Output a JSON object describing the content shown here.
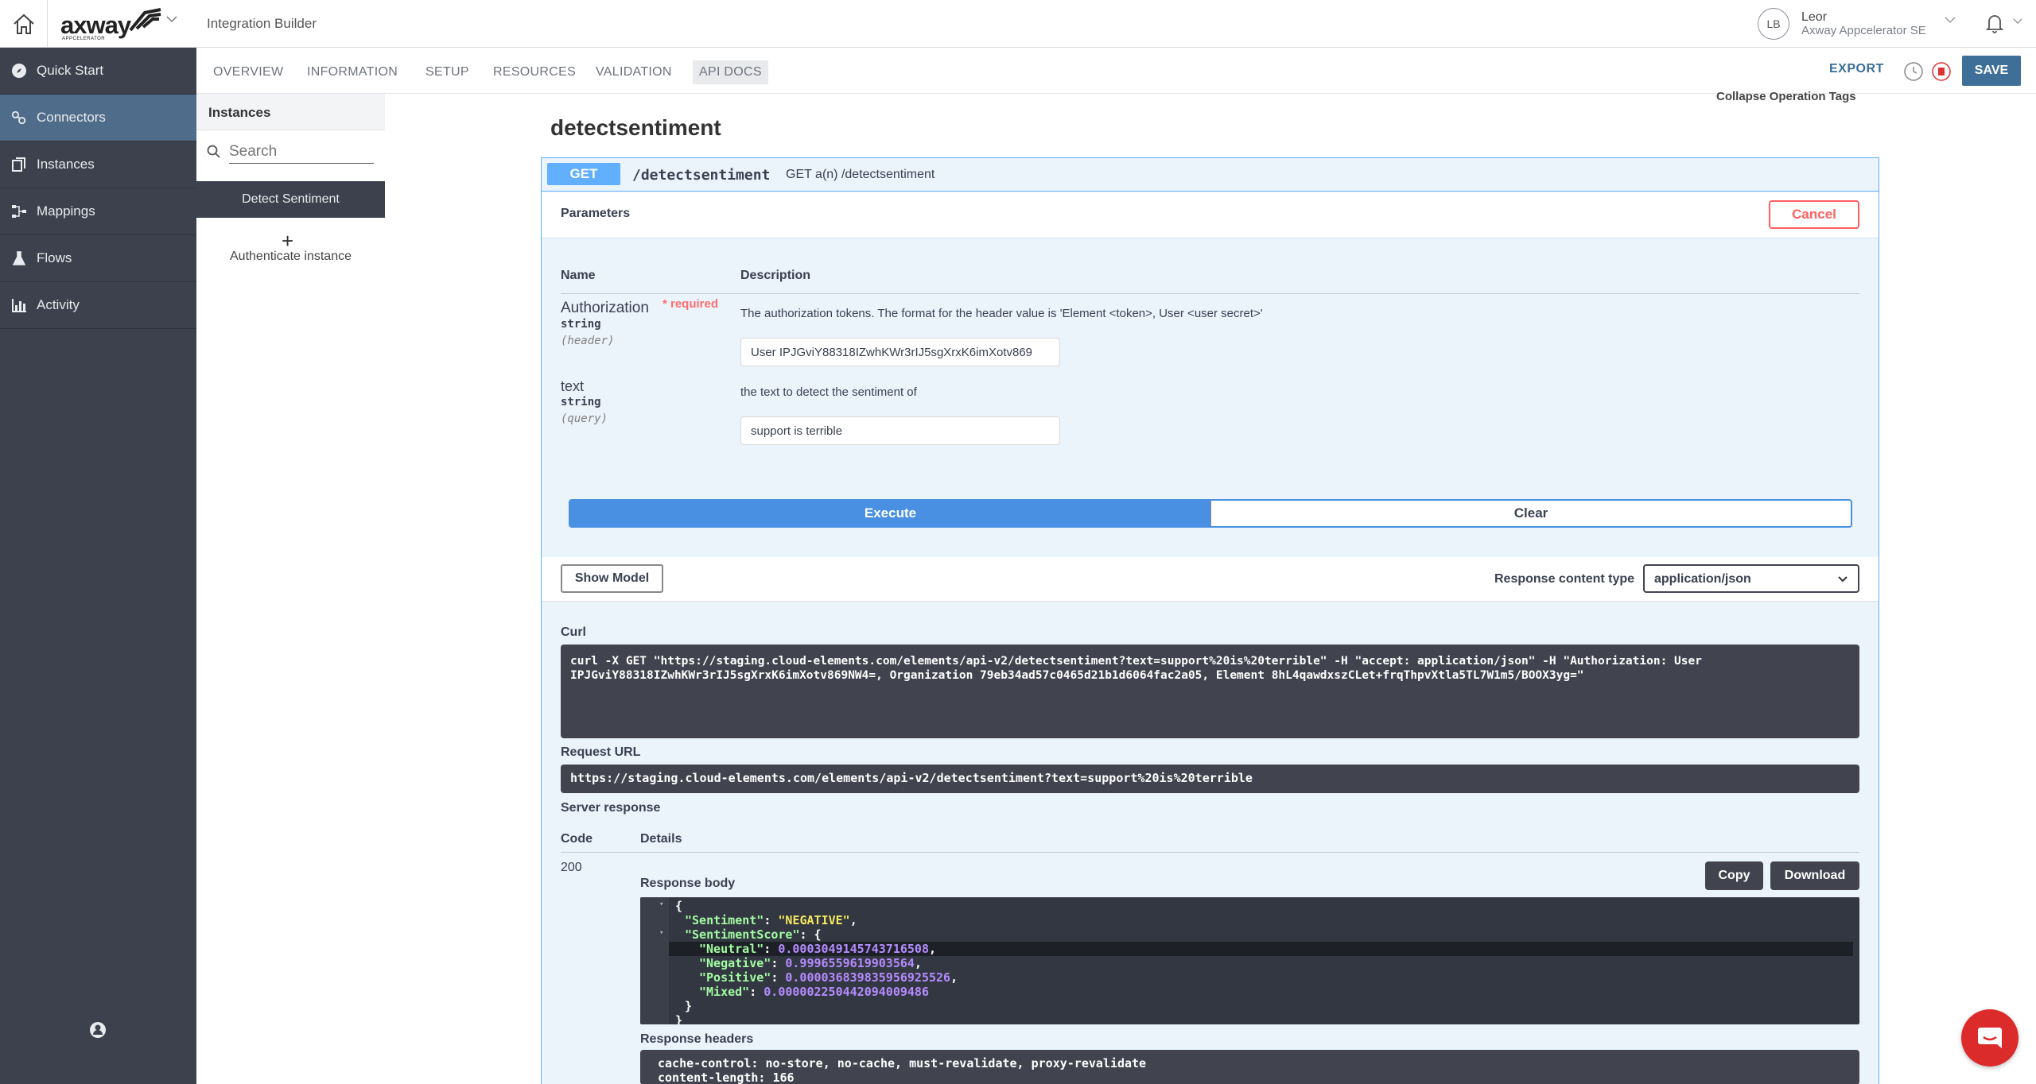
{
  "topbar": {
    "logo_text": "axway",
    "logo_sub": "APPCELERATOR",
    "app_title": "Integration Builder",
    "user_initials": "LB",
    "user_name": "Leor",
    "user_org": "Axway Appcelerator SE"
  },
  "sidebar": {
    "items": [
      {
        "label": "Quick Start",
        "icon": "compass-icon"
      },
      {
        "label": "Connectors",
        "icon": "connectors-icon",
        "active": true
      },
      {
        "label": "Instances",
        "icon": "instances-icon"
      },
      {
        "label": "Mappings",
        "icon": "mappings-icon"
      },
      {
        "label": "Flows",
        "icon": "flask-icon"
      },
      {
        "label": "Activity",
        "icon": "bar-chart-icon"
      }
    ],
    "active_color": "#4f6d8a",
    "bg_color": "#3c414d"
  },
  "tabs": [
    "OVERVIEW",
    "INFORMATION",
    "SETUP",
    "RESOURCES",
    "VALIDATION",
    "API DOCS"
  ],
  "active_tab": "API DOCS",
  "actions": {
    "export": "EXPORT",
    "save": "SAVE"
  },
  "instances": {
    "header": "Instances",
    "search_placeholder": "Search",
    "selected": "Detect Sentiment",
    "add_label": "+",
    "authenticate": "Authenticate instance"
  },
  "api": {
    "collapse_tags": "Collapse Operation Tags",
    "title": "detectsentiment",
    "method": "GET",
    "path": "/detectsentiment",
    "summary": "GET a(n) /detectsentiment",
    "parameters_title": "Parameters",
    "cancel": "Cancel",
    "col_name": "Name",
    "col_description": "Description",
    "params": [
      {
        "name": "Authorization",
        "required": "* required",
        "type": "string",
        "in": "(header)",
        "description": "The authorization tokens. The format for the header value is 'Element <token>, User <user secret>'",
        "value": "User IPJGviY88318IZwhKWr3rIJ5sgXrxK6imXotv869"
      },
      {
        "name": "text",
        "type": "string",
        "in": "(query)",
        "description": "the text to detect the sentiment of",
        "value": "support is terrible"
      }
    ],
    "execute": "Execute",
    "clear": "Clear",
    "show_model": "Show Model",
    "response_content_type_label": "Response content type",
    "response_content_type": "application/json",
    "curl_label": "Curl",
    "curl": "curl -X GET \"https://staging.cloud-elements.com/elements/api-v2/detectsentiment?text=support%20is%20terrible\" -H \"accept: application/json\" -H \"Authorization: User\nIPJGviY88318IZwhKWr3rIJ5sgXrxK6imXotv869NW4=, Organization 79eb34ad57c0465d21b1d6064fac2a05, Element 8hL4qawdxszCLet+frqThpvXtla5TL7W1m5/BOOX3yg=\"",
    "request_url_label": "Request URL",
    "request_url": "https://staging.cloud-elements.com/elements/api-v2/detectsentiment?text=support%20is%20terrible",
    "server_response_label": "Server response",
    "code_label": "Code",
    "details_label": "Details",
    "code": "200",
    "response_body_label": "Response body",
    "copy": "Copy",
    "download": "Download",
    "response_body": {
      "sentiment_key": "\"Sentiment\"",
      "sentiment_value": "\"NEGATIVE\"",
      "score_key": "\"SentimentScore\"",
      "neutral_key": "\"Neutral\"",
      "neutral_value": "0.0003049145743716508",
      "negative_key": "\"Negative\"",
      "negative_value": "0.9996559619903564",
      "positive_key": "\"Positive\"",
      "positive_value": "0.000036839835956925526",
      "mixed_key": "\"Mixed\"",
      "mixed_value": "0.000002250442094009486"
    },
    "response_headers_label": "Response headers",
    "response_headers": "cache-control: no-store, no-cache, must-revalidate, proxy-revalidate\ncontent-length: 166"
  }
}
